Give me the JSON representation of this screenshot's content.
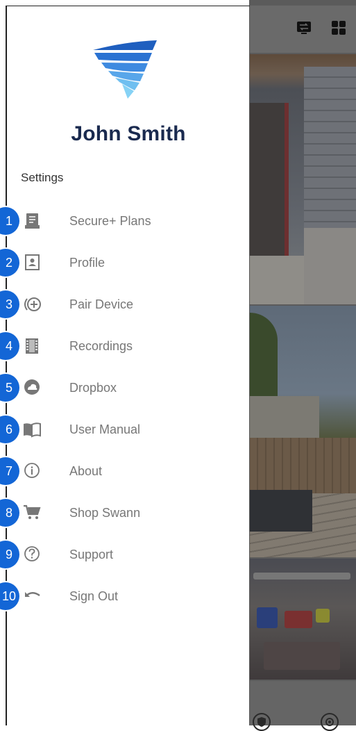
{
  "user": {
    "name": "John Smith"
  },
  "settings": {
    "title": "Settings",
    "items": [
      {
        "num": "1",
        "label": "Secure+ Plans",
        "icon": "plan-document-icon"
      },
      {
        "num": "2",
        "label": "Profile",
        "icon": "profile-icon"
      },
      {
        "num": "3",
        "label": "Pair Device",
        "icon": "pair-device-icon"
      },
      {
        "num": "4",
        "label": "Recordings",
        "icon": "recordings-film-icon"
      },
      {
        "num": "5",
        "label": "Dropbox",
        "icon": "cloud-icon"
      },
      {
        "num": "6",
        "label": "User Manual",
        "icon": "book-icon"
      },
      {
        "num": "7",
        "label": "About",
        "icon": "info-icon"
      },
      {
        "num": "8",
        "label": "Shop Swann",
        "icon": "cart-icon"
      },
      {
        "num": "9",
        "label": "Support",
        "icon": "help-icon"
      },
      {
        "num": "10",
        "label": "Sign Out",
        "icon": "sign-out-icon"
      }
    ]
  },
  "colors": {
    "brand_blue": "#1366d6",
    "name_navy": "#1a2a4f",
    "label_gray": "#777777"
  },
  "background": {
    "top_icons": [
      "switch-view-icon",
      "grid-view-icon"
    ],
    "bottom_icons": [
      "shield-icon",
      "gear-icon"
    ]
  }
}
